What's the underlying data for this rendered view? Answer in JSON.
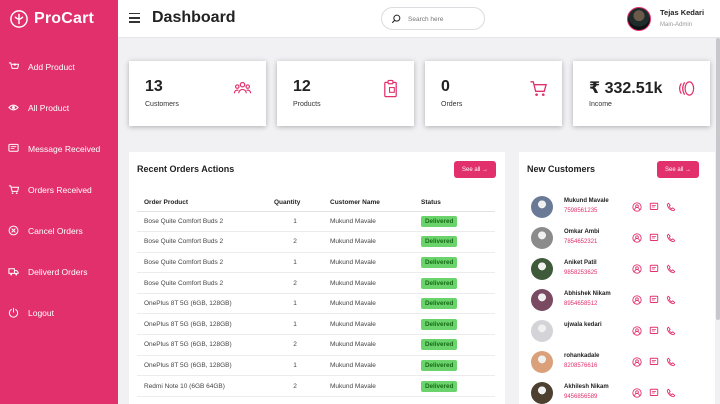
{
  "colors": {
    "accent": "#e1306c",
    "status_bg": "#6bd36b",
    "status_text": "#166c16",
    "page_bg": "#f1f1f4"
  },
  "sidebar": {
    "brand": "ProCart",
    "items": [
      {
        "label": "Add Product",
        "icon": "add-cart-icon"
      },
      {
        "label": "All Product",
        "icon": "eye-icon"
      },
      {
        "label": "Message Received",
        "icon": "message-icon"
      },
      {
        "label": "Orders Received",
        "icon": "cart-icon"
      },
      {
        "label": "Cancel Orders",
        "icon": "cancel-icon"
      },
      {
        "label": "Deliverd Orders",
        "icon": "truck-icon"
      },
      {
        "label": "Logout",
        "icon": "logout-icon"
      }
    ]
  },
  "header": {
    "title": "Dashboard",
    "search_placeholder": "Search here",
    "user_name": "Tejas Kedari",
    "user_role": "Main-Admin"
  },
  "cards": [
    {
      "value": "13",
      "label": "Customers",
      "icon": "users-icon"
    },
    {
      "value": "12",
      "label": "Products",
      "icon": "clipboard-icon"
    },
    {
      "value": "0",
      "label": "Orders",
      "icon": "cart-icon"
    },
    {
      "value": "₹ 332.51k",
      "label": "Income",
      "icon": "coins-icon"
    }
  ],
  "orders": {
    "title": "Recent Orders Actions",
    "see_all": "See all →",
    "columns": [
      "Order Product",
      "Quantity",
      "Customer Name",
      "Status"
    ],
    "rows": [
      {
        "product": "Bose Quite Comfort Buds 2",
        "qty": "1",
        "customer": "Mukund Mavale",
        "status": "Delivered"
      },
      {
        "product": "Bose Quite Comfort Buds 2",
        "qty": "2",
        "customer": "Mukund Mavale",
        "status": "Delivered"
      },
      {
        "product": "Bose Quite Comfort Buds 2",
        "qty": "1",
        "customer": "Mukund Mavale",
        "status": "Delivered"
      },
      {
        "product": "Bose Quite Comfort Buds 2",
        "qty": "2",
        "customer": "Mukund Mavale",
        "status": "Delivered"
      },
      {
        "product": "OnePlus 8T 5G (6GB, 128GB)",
        "qty": "1",
        "customer": "Mukund Mavale",
        "status": "Delivered"
      },
      {
        "product": "OnePlus 8T 5G (6GB, 128GB)",
        "qty": "1",
        "customer": "Mukund Mavale",
        "status": "Delivered"
      },
      {
        "product": "OnePlus 8T 5G (6GB, 128GB)",
        "qty": "2",
        "customer": "Mukund Mavale",
        "status": "Delivered"
      },
      {
        "product": "OnePlus 8T 5G (6GB, 128GB)",
        "qty": "1",
        "customer": "Mukund Mavale",
        "status": "Delivered"
      },
      {
        "product": "Redmi Note 10 (6GB 64GB)",
        "qty": "2",
        "customer": "Mukund Mavale",
        "status": "Delivered"
      }
    ]
  },
  "customers": {
    "title": "New Customers",
    "see_all": "See all →",
    "list": [
      {
        "name": "Mukund Mavale",
        "phone": "7598561235",
        "avatar": "#6a7a96"
      },
      {
        "name": "Omkar Ambi",
        "phone": "7854652321",
        "avatar": "#8b8b8b"
      },
      {
        "name": "Aniket Patil",
        "phone": "9858253625",
        "avatar": "#3e5a3a"
      },
      {
        "name": "Abhishek Nikam",
        "phone": "8954658512",
        "avatar": "#7a4a63"
      },
      {
        "name": "ujwala kedari",
        "phone": "",
        "avatar": "#d4d4d8"
      },
      {
        "name": "rohankadale",
        "phone": "8208576616",
        "avatar": "#d9a07a"
      },
      {
        "name": "Akhilesh Nikam",
        "phone": "9456856589",
        "avatar": "#4d4030"
      }
    ]
  }
}
